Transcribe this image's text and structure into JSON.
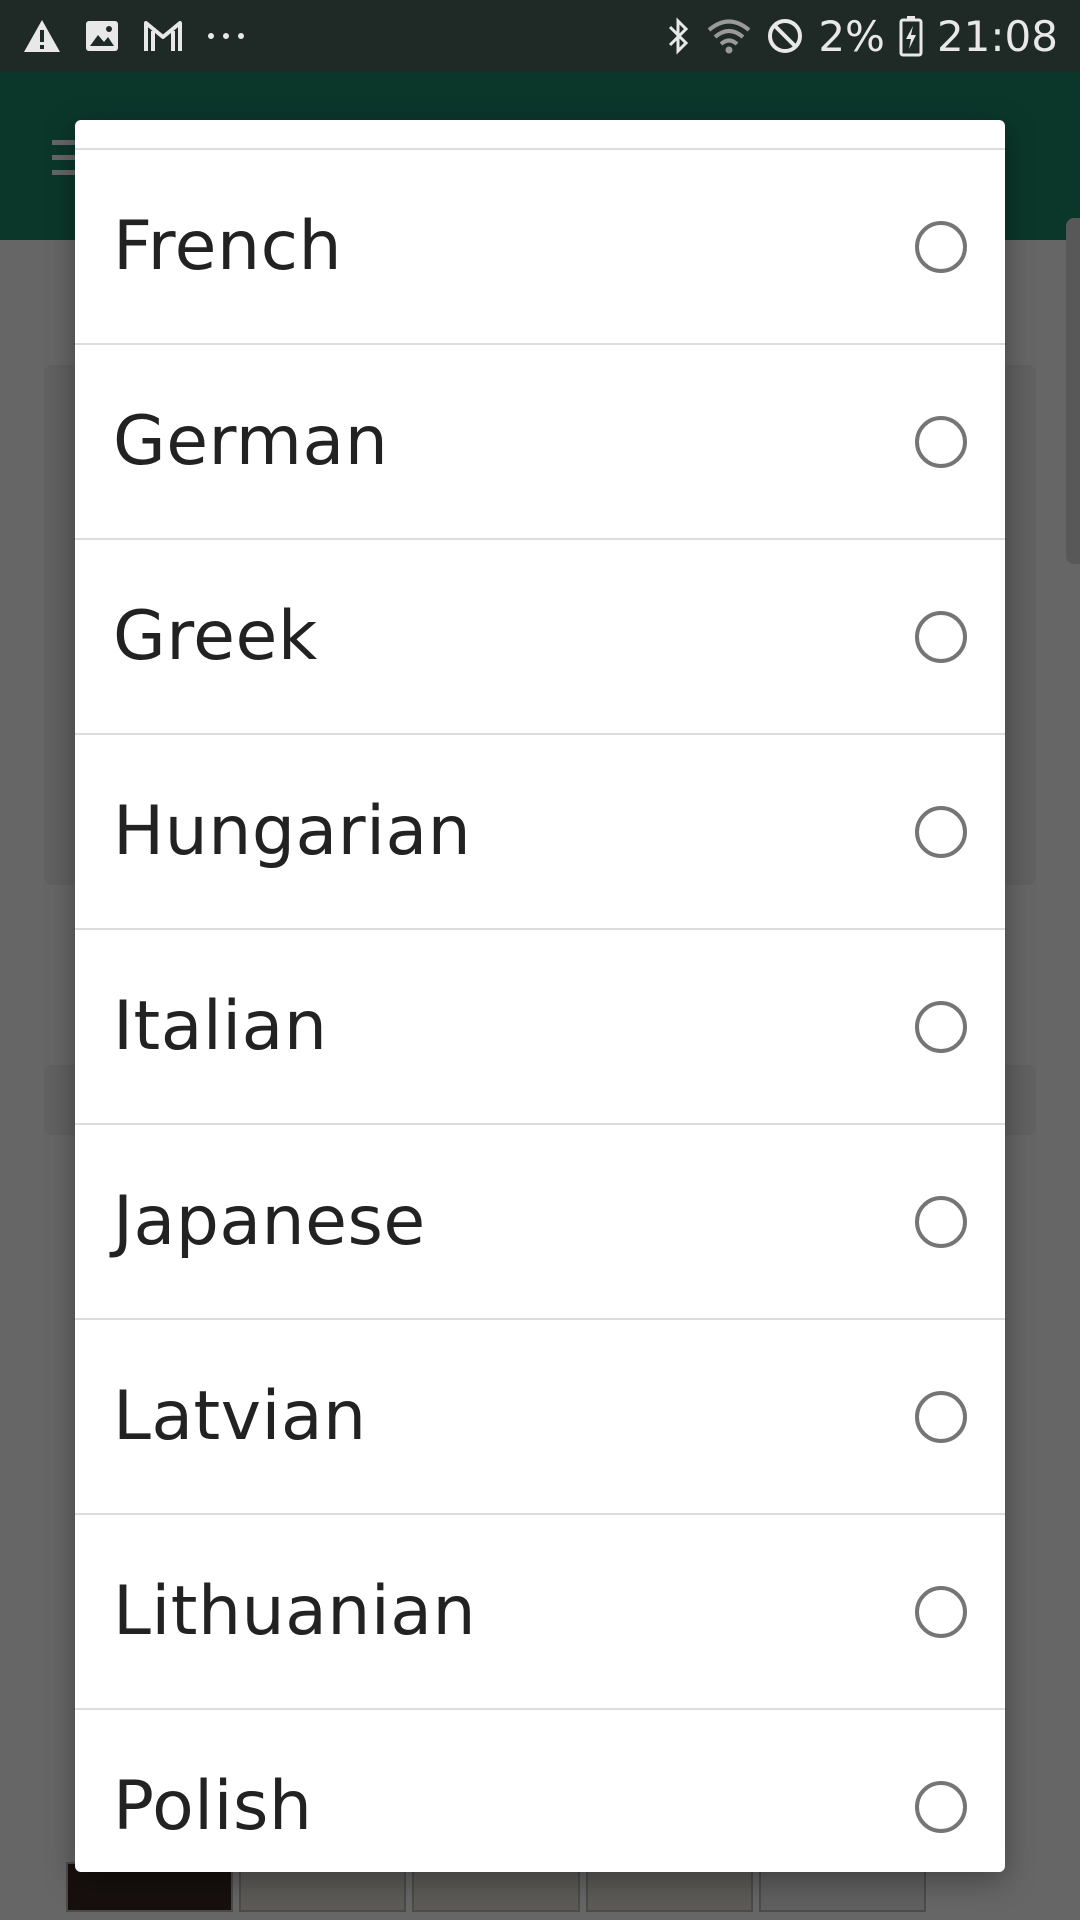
{
  "status_bar": {
    "icons_left": [
      "warning-icon",
      "image-icon",
      "gmail-icon",
      "more-icon"
    ],
    "battery_percent": "2%",
    "time": "21:08",
    "icons_right": [
      "bluetooth-icon",
      "wifi-icon",
      "do-not-disturb-icon",
      "battery-charging-icon"
    ]
  },
  "dialog": {
    "options": [
      {
        "label": "French",
        "selected": false
      },
      {
        "label": "German",
        "selected": false
      },
      {
        "label": "Greek",
        "selected": false
      },
      {
        "label": "Hungarian",
        "selected": false
      },
      {
        "label": "Italian",
        "selected": false
      },
      {
        "label": "Japanese",
        "selected": false
      },
      {
        "label": "Latvian",
        "selected": false
      },
      {
        "label": "Lithuanian",
        "selected": false
      },
      {
        "label": "Polish",
        "selected": false
      }
    ]
  },
  "colors": {
    "toolbar": "#1d8a6b",
    "status_bar": "#1f2a27",
    "radio_border": "#757575"
  }
}
